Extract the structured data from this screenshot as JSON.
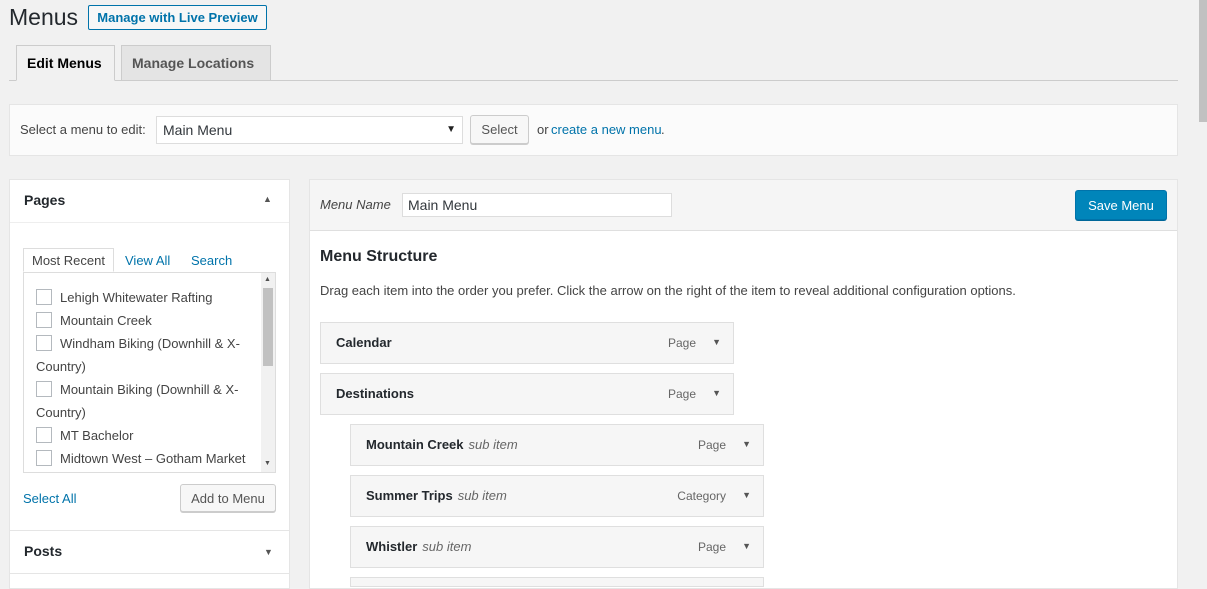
{
  "header": {
    "title": "Menus",
    "live_preview_label": "Manage with Live Preview"
  },
  "tabs": [
    {
      "label": "Edit Menus"
    },
    {
      "label": "Manage Locations"
    }
  ],
  "select_bar": {
    "label": "Select a menu to edit:",
    "selected_menu": "Main Menu",
    "select_button": "Select",
    "or_text": "or",
    "create_link": "create a new menu",
    "period": "."
  },
  "pages_box": {
    "title": "Pages",
    "subtabs": [
      "Most Recent",
      "View All",
      "Search"
    ],
    "items": [
      {
        "label": "Lehigh Whitewater Rafting"
      },
      {
        "label": "Mountain Creek"
      },
      {
        "label": "Windham Biking (Downhill & X-Country)"
      },
      {
        "label": "Mountain Biking (Downhill & X-Country)"
      },
      {
        "label": "MT Bachelor"
      },
      {
        "label": "Midtown West – Gotham Market"
      }
    ],
    "select_all": "Select All",
    "add_button": "Add to Menu"
  },
  "posts_box": {
    "title": "Posts"
  },
  "menu_editor": {
    "name_label": "Menu Name",
    "name_value": "Main Menu",
    "save_button": "Save Menu",
    "structure_title": "Menu Structure",
    "structure_desc": "Drag each item into the order you prefer. Click the arrow on the right of the item to reveal additional configuration options.",
    "items": [
      {
        "title": "Calendar",
        "sub": "",
        "type": "Page"
      },
      {
        "title": "Destinations",
        "sub": "",
        "type": "Page"
      },
      {
        "title": "Mountain Creek",
        "sub": "sub item",
        "type": "Page"
      },
      {
        "title": "Summer Trips",
        "sub": "sub item",
        "type": "Category"
      },
      {
        "title": "Whistler",
        "sub": "sub item",
        "type": "Page"
      }
    ]
  },
  "icons": {
    "dropdown": "▾",
    "toggle_up": "▲",
    "toggle_down": "▼"
  }
}
